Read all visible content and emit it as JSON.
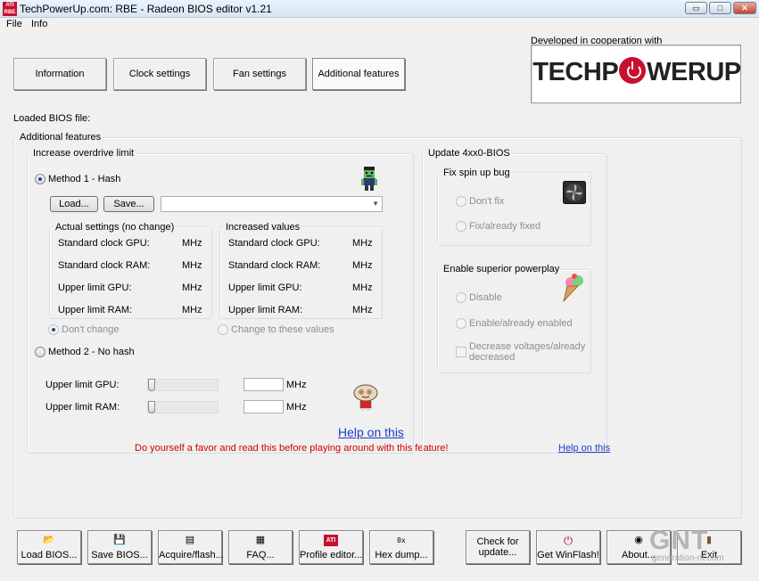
{
  "window": {
    "title": "TechPowerUp.com: RBE - Radeon BIOS editor v1.21",
    "icon_text": "ATI RBE",
    "minimize_glyph": "▭",
    "maximize_glyph": "□",
    "close_glyph": "✕"
  },
  "menu": {
    "file": "File",
    "info": "Info"
  },
  "tabs": [
    {
      "label": "Information"
    },
    {
      "label": "Clock settings"
    },
    {
      "label": "Fan settings"
    },
    {
      "label": "Additional features",
      "active": true
    }
  ],
  "logo": {
    "caption": "Developed in cooperation with",
    "text_left": "TECHP",
    "text_right": "WERUP",
    "color": "#c8102e"
  },
  "loaded_bios_label": "Loaded BIOS file:",
  "additional_features": {
    "title": "Additional features",
    "overdrive": {
      "title": "Increase overdrive limit",
      "method1": {
        "label": "Method 1 - Hash",
        "selected": true,
        "load_button": "Load...",
        "save_button": "Save...",
        "combo_value": ""
      },
      "actual": {
        "title": "Actual settings (no change)",
        "rows": [
          {
            "label": "Standard clock GPU:",
            "unit": "MHz"
          },
          {
            "label": "Standard clock RAM:",
            "unit": "MHz"
          },
          {
            "label": "Upper limit GPU:",
            "unit": "MHz"
          },
          {
            "label": "Upper limit RAM:",
            "unit": "MHz"
          }
        ]
      },
      "increased": {
        "title": "Increased values",
        "rows": [
          {
            "label": "Standard clock GPU:",
            "unit": "MHz"
          },
          {
            "label": "Standard clock RAM:",
            "unit": "MHz"
          },
          {
            "label": "Upper limit GPU:",
            "unit": "MHz"
          },
          {
            "label": "Upper limit RAM:",
            "unit": "MHz"
          }
        ]
      },
      "dont_change": "Don't change",
      "change_to": "Change to these values",
      "method2": {
        "label": "Method 2 - No hash",
        "selected": false,
        "gpu_label": "Upper limit GPU:",
        "ram_label": "Upper limit RAM:",
        "unit": "MHz",
        "gpu_value": "",
        "ram_value": ""
      },
      "help_link": "Help on this",
      "warning": "Do yourself a favor and read this before playing around with this feature!"
    },
    "update_4xx0": {
      "title": "Update 4xx0-BIOS",
      "fix_spin": {
        "title": "Fix spin up bug",
        "dont_fix": "Don't fix",
        "fix_already": "Fix/already fixed"
      },
      "powerplay": {
        "title": "Enable superior powerplay",
        "disable": "Disable",
        "enable": "Enable/already enabled",
        "decrease_line1": "Decrease voltages/already",
        "decrease_line2": "decreased"
      },
      "help_link": "Help on this"
    }
  },
  "bottom_buttons": [
    {
      "label": "Load BIOS...",
      "icon": "📂"
    },
    {
      "label": "Save BIOS...",
      "icon": "💾"
    },
    {
      "label": "Acquire/flash...",
      "icon": "▤"
    },
    {
      "label": "FAQ...",
      "icon": "▦"
    },
    {
      "label": "Profile editor...",
      "icon": "ATI"
    },
    {
      "label": "Hex dump...",
      "icon": "0x"
    },
    {
      "label_line1": "Check for",
      "label_line2": "update..."
    },
    {
      "label": "Get WinFlash!",
      "icon": "⏻"
    },
    {
      "label": "About...",
      "icon": "◉"
    },
    {
      "label": "Exit",
      "icon": "▮"
    }
  ],
  "watermark": {
    "main": "GNT",
    "sub": "generation-nt.com"
  }
}
